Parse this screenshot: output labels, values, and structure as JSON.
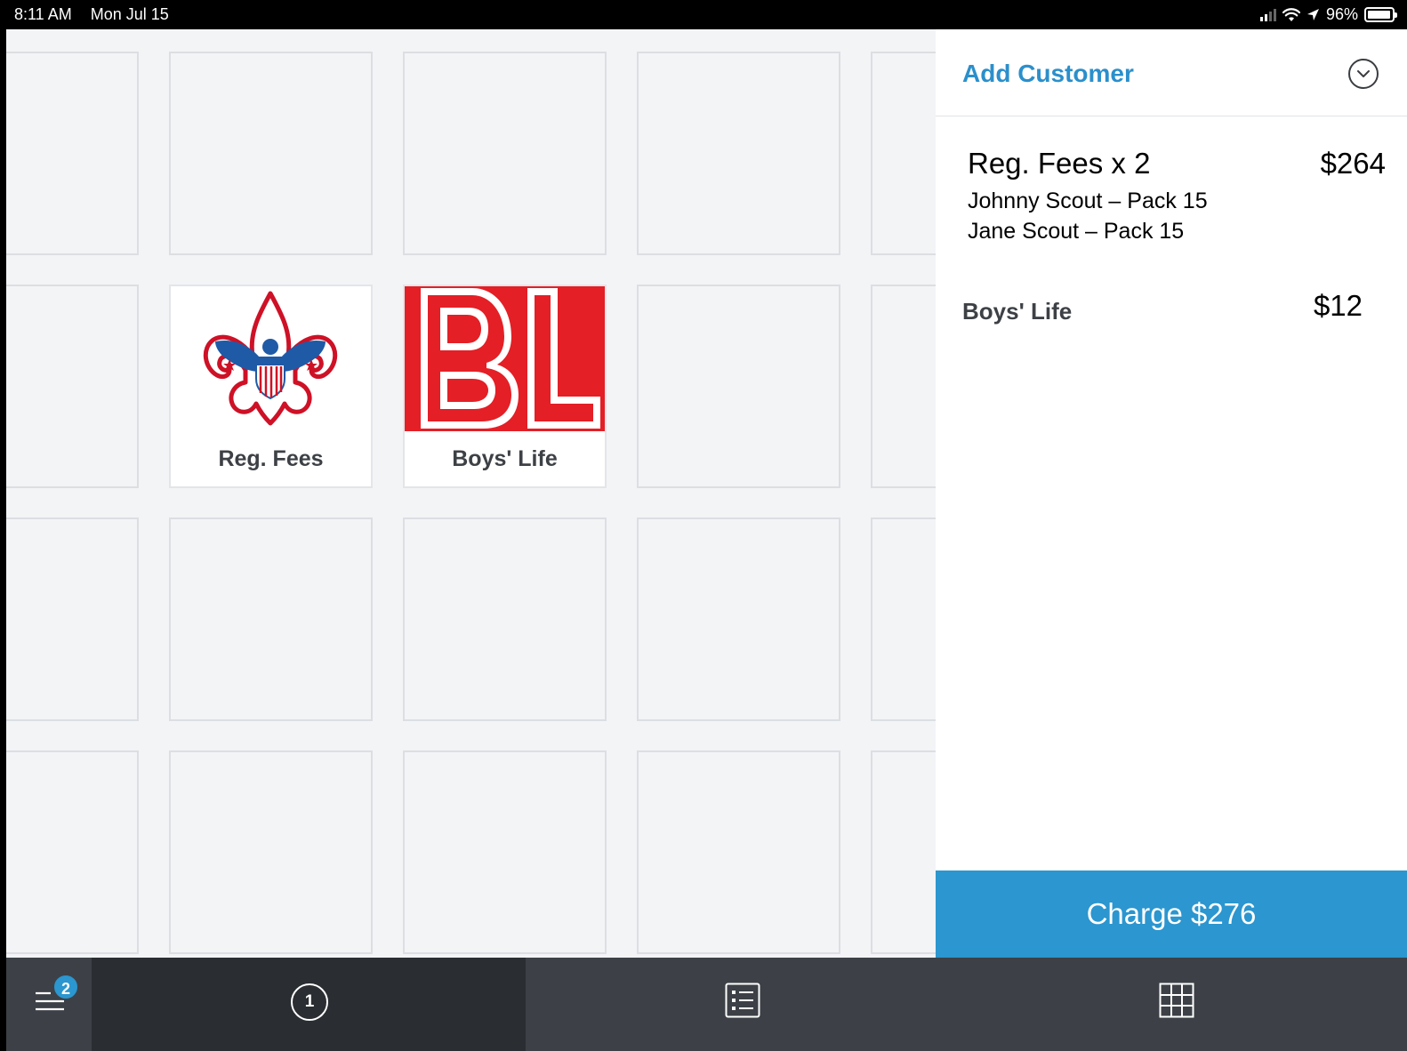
{
  "status_bar": {
    "time": "8:11 AM",
    "date": "Mon Jul 15",
    "battery": "96%",
    "battery_level": 0.96
  },
  "grid": {
    "items": [
      {
        "label": "Reg. Fees",
        "logo": "fleur-de-lis-eagle-logo"
      },
      {
        "label": "Boys' Life",
        "logo": "bl-logo"
      }
    ]
  },
  "cart": {
    "add_customer": "Add Customer",
    "lines": [
      {
        "name": "Reg. Fees x 2",
        "price": "$264",
        "details": [
          "Johnny Scout – Pack 15",
          "Jane Scout – Pack 15"
        ]
      },
      {
        "name": "Boys' Life",
        "price": "$12"
      }
    ],
    "charge_label": "Charge $276"
  },
  "tabbar": {
    "menu_badge": "2",
    "sale_count": "1"
  },
  "colors": {
    "accent": "#2b96cf",
    "link": "#2b8fcb",
    "tabbar": "#3d4147",
    "tab_active": "#2a2d31",
    "bl_red": "#e41f26",
    "bsa_red": "#ce1126",
    "bsa_blue": "#1f5aa6"
  }
}
